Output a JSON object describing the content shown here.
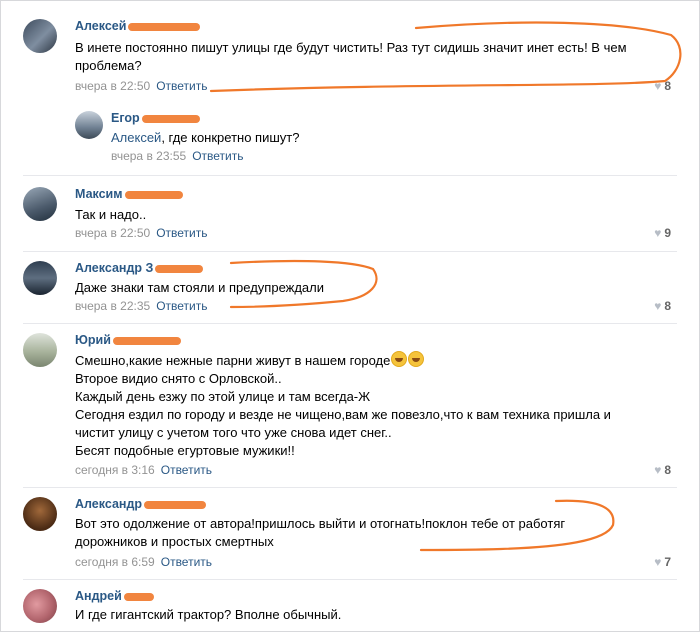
{
  "reply_label": "Ответить",
  "comments": [
    {
      "author": "Алексей",
      "text": [
        "В инете постоянно пишут улицы где будут чистить! Раз тут сидишь значит инет есть! В чем",
        "проблема?"
      ],
      "time": "вчера в 22:50",
      "likes": "8"
    },
    {
      "author": "Егор",
      "mention": "Алексей",
      "text_rest": ", где конкретно пишут?",
      "time": "вчера в 23:55"
    },
    {
      "author": "Максим",
      "text": [
        "Так и надо.."
      ],
      "time": "вчера в 22:50",
      "likes": "9"
    },
    {
      "author": "Александр З",
      "text": [
        "Даже знаки там стояли и предупреждали"
      ],
      "time": "вчера в 22:35",
      "likes": "8"
    },
    {
      "author": "Юрий",
      "text": [
        "Смешно,какие нежные парни живут в нашем городе",
        "Второе видио снято с Орловской..",
        "Каждый день езжу по этой улице и там всегда-Ж",
        "Сегодня ездил по городу и везде не чищено,вам же повезло,что к вам техника пришла и",
        "чистит улицу с учетом того что уже снова идет снег..",
        "Бесят подобные егуртовые мужики!!"
      ],
      "time": "сегодня в 3:16",
      "likes": "8"
    },
    {
      "author": "Александр",
      "text": [
        "Вот это одолжение от автора!пришлось выйти и отогнать!поклон тебе от работяг",
        "дорожников и простых смертных"
      ],
      "time": "сегодня в 6:59",
      "likes": "7"
    },
    {
      "author": "Андрей",
      "text": [
        "И где гигантский трактор? Вполне обычный."
      ]
    }
  ],
  "colors": {
    "link": "#2a5885",
    "meta": "#939393",
    "annotation": "#f0782a"
  },
  "icons": {
    "like": "heart-icon"
  }
}
